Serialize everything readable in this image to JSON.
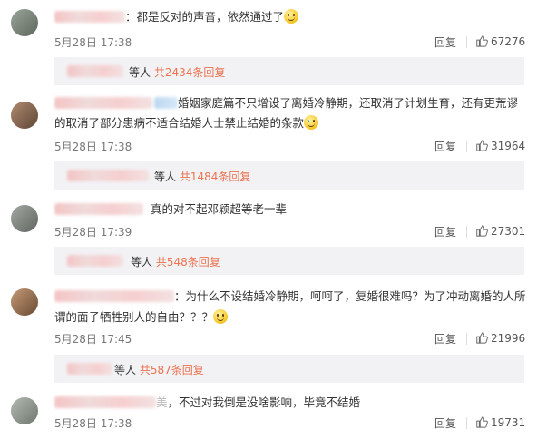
{
  "comments": [
    {
      "text": "：都是反对的声音，依然通过了",
      "time": "5月28日 17:38",
      "reply_label": "回复",
      "likes": "67276",
      "avatar_color": "#6f7a6e"
    },
    {
      "text_line1": "婚姻家庭篇不只增设了离婚冷静期，还取消了计划生育，还有更荒谬",
      "text_line2": "的取消了部分患病不适合结婚人士禁止结婚的条款",
      "time": "5月28日 17:38",
      "reply_label": "回复",
      "likes": "31964",
      "avatar_color": "#8a6a55"
    },
    {
      "text": "真的对不起邓颖超等老一辈",
      "time": "5月28日 17:39",
      "reply_label": "回复",
      "likes": "27301",
      "avatar_color": "#7b8078"
    },
    {
      "text_line1": "：为什么不设结婚冷静期，呵呵了，复婚很难吗？为了冲动离婚的人所",
      "text_line2": "谓的面子牺牲别人的自由？？？",
      "time": "5月28日 17:45",
      "reply_label": "回复",
      "likes": "21996",
      "avatar_color": "#9a6f4c"
    },
    {
      "text": "，不过对我倒是没啥影响，毕竟不结婚",
      "text_prefix": "美",
      "time": "5月28日 17:38",
      "reply_label": "回复",
      "likes": "19731",
      "avatar_color": "#8f9a8e"
    }
  ],
  "subreplies": [
    {
      "prefix": "等人",
      "count_text": "共2434条回复"
    },
    {
      "prefix": "等人",
      "count_text": "共1484条回复"
    },
    {
      "prefix": "等人",
      "count_text": "共548条回复"
    },
    {
      "prefix": "等人",
      "count_text": "共587条回复"
    }
  ],
  "colors": {
    "accent": "#eb7350",
    "subbox_bg": "#f2f2f5",
    "text": "#333333",
    "meta": "#777777"
  },
  "icons": {
    "like": "thumbs-up-icon",
    "smile": "smile-emoji-icon",
    "cry": "cry-emoji-icon"
  }
}
